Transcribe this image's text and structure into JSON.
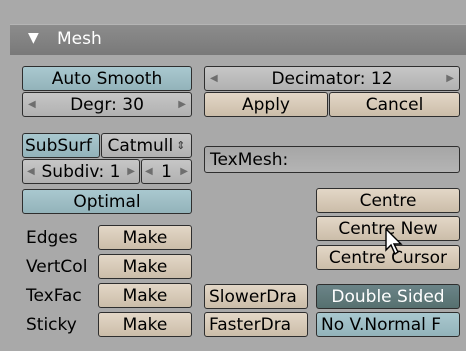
{
  "header": {
    "title": "Mesh",
    "collapse_icon": "triangle-down-icon"
  },
  "smooth": {
    "auto_smooth": "Auto Smooth",
    "degr": "Degr: 30"
  },
  "decimator": {
    "label": "Decimator: 12",
    "apply": "Apply",
    "cancel": "Cancel"
  },
  "subsurf": {
    "label": "SubSurf",
    "type": "Catmull",
    "subdiv": "Subdiv: 1",
    "render_level": "1",
    "optimal": "Optimal"
  },
  "texmesh": {
    "label": "TexMesh:"
  },
  "centre": {
    "centre": "Centre",
    "centre_new": "Centre New",
    "centre_cursor": "Centre Cursor"
  },
  "make_rows": [
    {
      "label": "Edges",
      "button": "Make"
    },
    {
      "label": "VertCol",
      "button": "Make"
    },
    {
      "label": "TexFac",
      "button": "Make"
    },
    {
      "label": "Sticky",
      "button": "Make"
    }
  ],
  "draw": {
    "slower": "SlowerDra",
    "faster": "FasterDra"
  },
  "sided": {
    "double": "Double Sided",
    "no_vnormal": "No V.Normal F"
  }
}
